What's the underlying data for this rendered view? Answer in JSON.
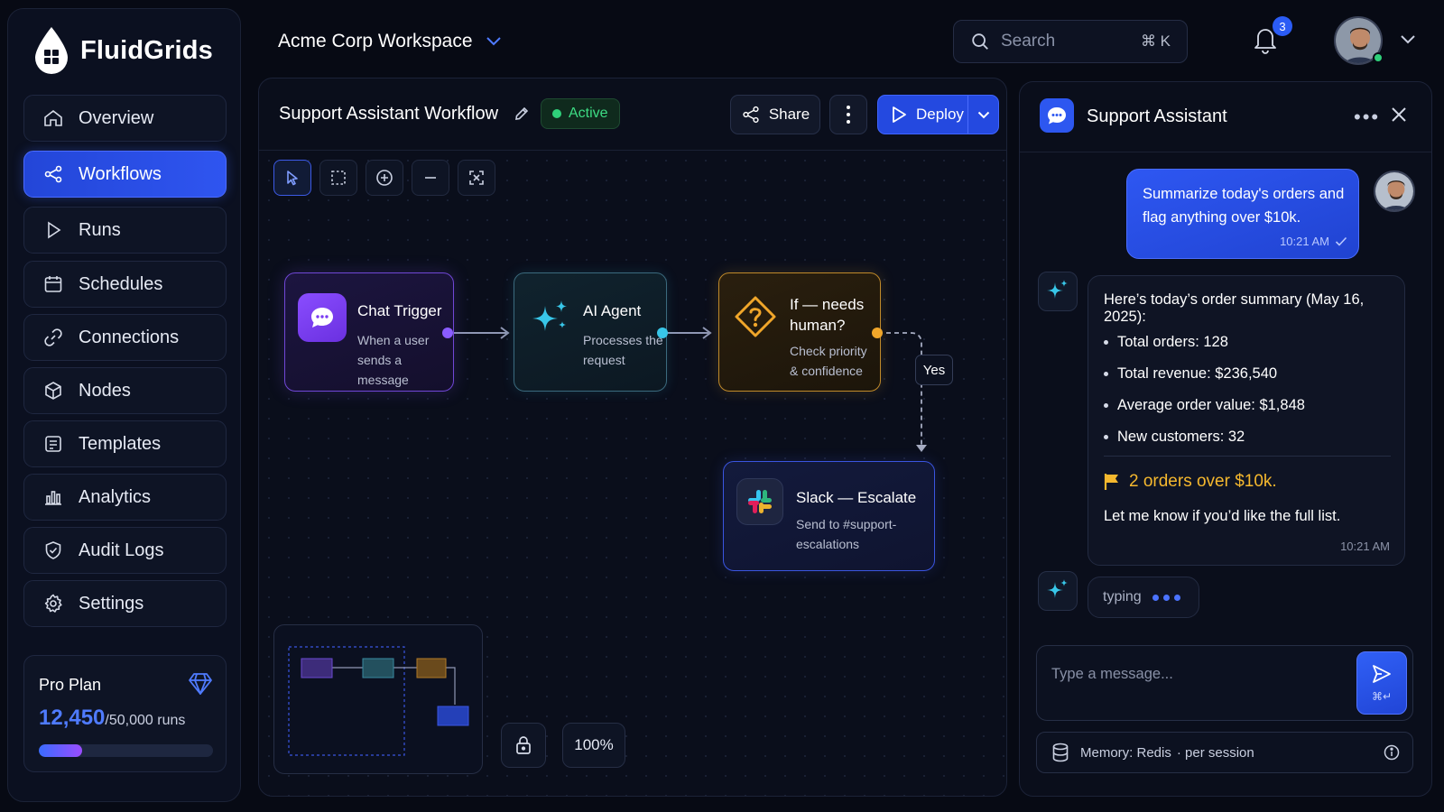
{
  "brand": {
    "name": "FluidGrids"
  },
  "sidebar": {
    "items": [
      {
        "label": "Overview",
        "icon": "home-icon"
      },
      {
        "label": "Workflows",
        "icon": "workflow-icon",
        "active": true
      },
      {
        "label": "Runs",
        "icon": "play-icon"
      },
      {
        "label": "Schedules",
        "icon": "calendar-icon"
      },
      {
        "label": "Connections",
        "icon": "link-icon"
      },
      {
        "label": "Nodes",
        "icon": "cube-icon"
      },
      {
        "label": "Templates",
        "icon": "template-icon"
      },
      {
        "label": "Analytics",
        "icon": "bar-chart-icon"
      },
      {
        "label": "Audit Logs",
        "icon": "shield-icon"
      },
      {
        "label": "Settings",
        "icon": "gear-icon"
      }
    ]
  },
  "plan": {
    "name": "Pro Plan",
    "used": "12,450",
    "limit": "/50,000 runs",
    "progress": 0.249,
    "icon": "diamond-icon"
  },
  "topbar": {
    "workspace": "Acme Corp Workspace",
    "search_placeholder": "Search",
    "search_shortcut": "⌘ K",
    "notifications": "3"
  },
  "workflow": {
    "title": "Support Assistant Workflow",
    "status": "Active",
    "share_label": "Share",
    "deploy_label": "Deploy",
    "zoom": "100%",
    "edge_label": "Yes",
    "nodes": {
      "chat": {
        "title": "Chat Trigger",
        "sub1": "When a user",
        "sub2": "sends a message"
      },
      "agent": {
        "title": "AI Agent",
        "sub1": "Processes the",
        "sub2": "request"
      },
      "cond": {
        "title1": "If — needs",
        "title2": "human?",
        "sub1": "Check priority",
        "sub2": "& confidence"
      },
      "slack": {
        "title": "Slack — Escalate",
        "sub1": "Send to #support-",
        "sub2": "escalations"
      }
    }
  },
  "chat": {
    "title": "Support Assistant",
    "user_message": "Summarize today's orders and flag anything over $10k.",
    "user_time": "10:21 AM",
    "bot_intro": "Here’s today’s order summary (May 16, 2025):",
    "bot_items": [
      "Total orders: 128",
      "Total revenue: $236,540",
      "Average order value: $1,848",
      "New customers: 32"
    ],
    "bot_flag": "2 orders over $10k.",
    "bot_note": "Let me know if you’d like the full list.",
    "bot_time": "10:21 AM",
    "typing_label": "typing",
    "composer_placeholder": "Type a message...",
    "send_shortcut": "⌘↵",
    "memory_label": "Memory: Redis",
    "memory_scope": "· per session"
  },
  "colors": {
    "accent": "#2f55f0",
    "chat_node": "#7b3cf0",
    "agent_node": "#2fb8d8",
    "condition_node": "#f0a62a",
    "slack_node": "#3a55e0",
    "status_active": "#2fd07a"
  }
}
